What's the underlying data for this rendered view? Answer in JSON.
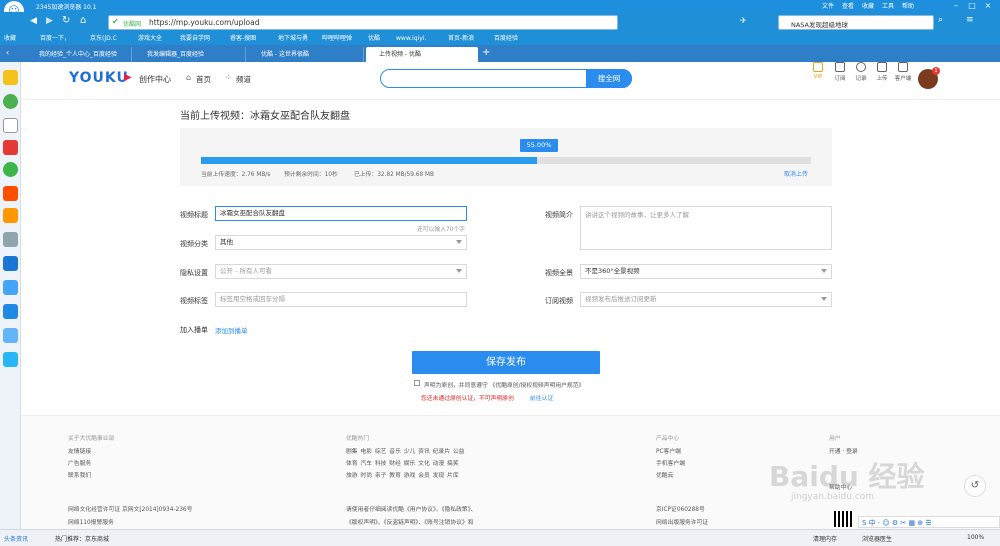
{
  "browser": {
    "title": "2345加速浏览器 10.1",
    "menu": [
      "文件",
      "查看",
      "收藏",
      "工具",
      "帮助"
    ],
    "address": {
      "safety": "优酷网",
      "url": "https://mp.youku.com/upload"
    },
    "search_text": "NASA发现超级地球",
    "bookmarks": [
      "收藏",
      "百度一下，",
      "京东(JD.C",
      "游戏大全",
      "我要自学网",
      "睿客-搜图",
      "地下城与勇",
      "哔哩哔哩弹",
      "优酷",
      "www.iqiyi.",
      "首页-新浪",
      "百度经验"
    ],
    "tabs": [
      "我的经验_个人中心_百度经验",
      "我发编辑器_百度经验",
      "优酷 - 这世界很酷",
      "上传视频 - 优酷"
    ],
    "active_tab": 3
  },
  "header": {
    "logo": "YOUKU",
    "center": "创作中心",
    "nav_home": "首页",
    "nav_channel": "频道",
    "search_button": "搜全网",
    "icons": [
      {
        "name": "vip-icon",
        "label": "VIP"
      },
      {
        "name": "subscribe-icon",
        "label": "订阅"
      },
      {
        "name": "history-icon",
        "label": "记录"
      },
      {
        "name": "upload-icon",
        "label": "上传"
      },
      {
        "name": "client-icon",
        "label": "客户端"
      }
    ],
    "avatar_badge": "1"
  },
  "upload": {
    "heading": "当前上传视频：冰霜女巫配合队友翻盘",
    "progress": 0.55,
    "progress_label": "55.00%",
    "speed": "当前上传速度：2.76 MB/s",
    "remaining": "预计剩余时间：10秒",
    "uploaded": "已上传：32.82 MB/59.68 MB",
    "cancel": "取消上传"
  },
  "form": {
    "title_label": "视频标题",
    "title_value": "冰霜女巫配合队友翻盘",
    "title_hint": "还可以输入70个字",
    "intro_label": "视频简介",
    "intro_placeholder": "讲讲这个视频的故事，让更多人了解",
    "category_label": "视频分类",
    "category_value": "其他",
    "privacy_label": "隐私设置",
    "privacy_value": "公开 - 所有人可看",
    "panorama_label": "视频全景",
    "panorama_value": "不是360°全景视频",
    "tags_label": "视频标签",
    "tags_placeholder": "标签用空格或回车分隔",
    "sub_label": "订阅视频",
    "sub_placeholder": "视频发布后推送订阅更新",
    "playlist_label": "加入播单",
    "playlist_link": "添加到播单",
    "publish": "保存发布",
    "agree": "声明为原创，并同意遵守 《优酷原创/授权视频声明用户规范》",
    "warn": "您还未通过原创认证，不可声明原创",
    "auth": "前往认证"
  },
  "footer": {
    "col1_head": "关于大优酷事业部",
    "col1": [
      "友情链接",
      "广告服务",
      "联系我们"
    ],
    "col2_head": "优酷热门",
    "col2_rows": [
      "剧集 电影 综艺 音乐 少儿 资讯 纪录片 公益",
      "体育 汽车 科技 财经 娱乐 文化 动漫 搞笑",
      "旅游 时尚 亲子 教育 游戏 会员 发现 片库"
    ],
    "col3_head": "产品中心",
    "col3": [
      "PC客户端",
      "手机客户端",
      "优酷云"
    ],
    "col4_head": "用户",
    "col4": [
      "开通 · 登录",
      "",
      "帮助中心"
    ],
    "license1": "网络文化经营许可证 京网文[2014]0934-236号",
    "license2": "网络110报警服务",
    "notice1": "请使用者仔细阅读优酷《用户协议》、《隐私政策》、",
    "notice2": "《版权声明》、《反盗链声明》、《账号注销协议》和",
    "icp1": "京ICP证060288号",
    "icp2": "网络出版服务许可证"
  },
  "watermark": {
    "brand": "Baidu 经验",
    "site": "jingyan.baidu.com"
  },
  "status": {
    "left": "头条资讯",
    "hot": "热门推荐：京东商城",
    "clear": "清理内存",
    "doctor": "浏览器医生",
    "zoom": "100%"
  },
  "colors": {
    "accent": "#2b8cf0",
    "browser": "#1f8fd8",
    "warn": "#e02020",
    "progress": "#2a9cf0"
  }
}
